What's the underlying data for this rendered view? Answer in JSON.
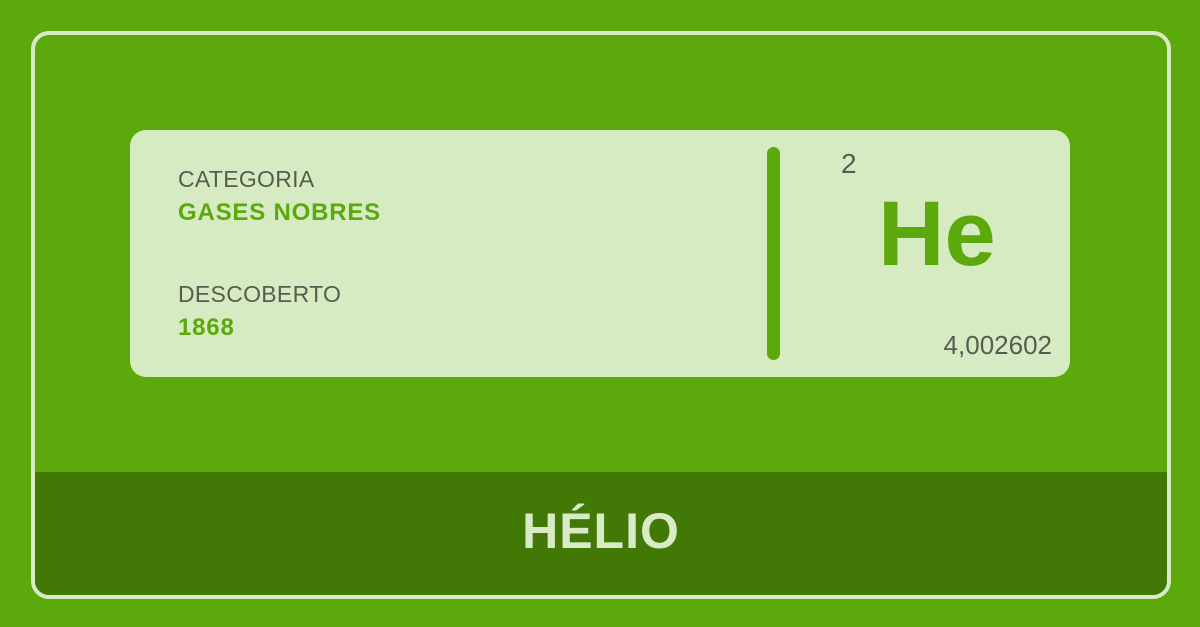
{
  "element": {
    "category_label": "CATEGORIA",
    "category_value": "GASES NOBRES",
    "discovered_label": "DESCOBERTO",
    "discovered_value": "1868",
    "atomic_number": "2",
    "symbol": "He",
    "atomic_mass": "4,002602",
    "name": "HÉLIO"
  },
  "colors": {
    "background": "#5ca90b",
    "card": "#d7ebc3",
    "footer": "#427906",
    "text_muted": "#555d50",
    "accent": "#5ca90b",
    "light": "#d9ebc6"
  }
}
